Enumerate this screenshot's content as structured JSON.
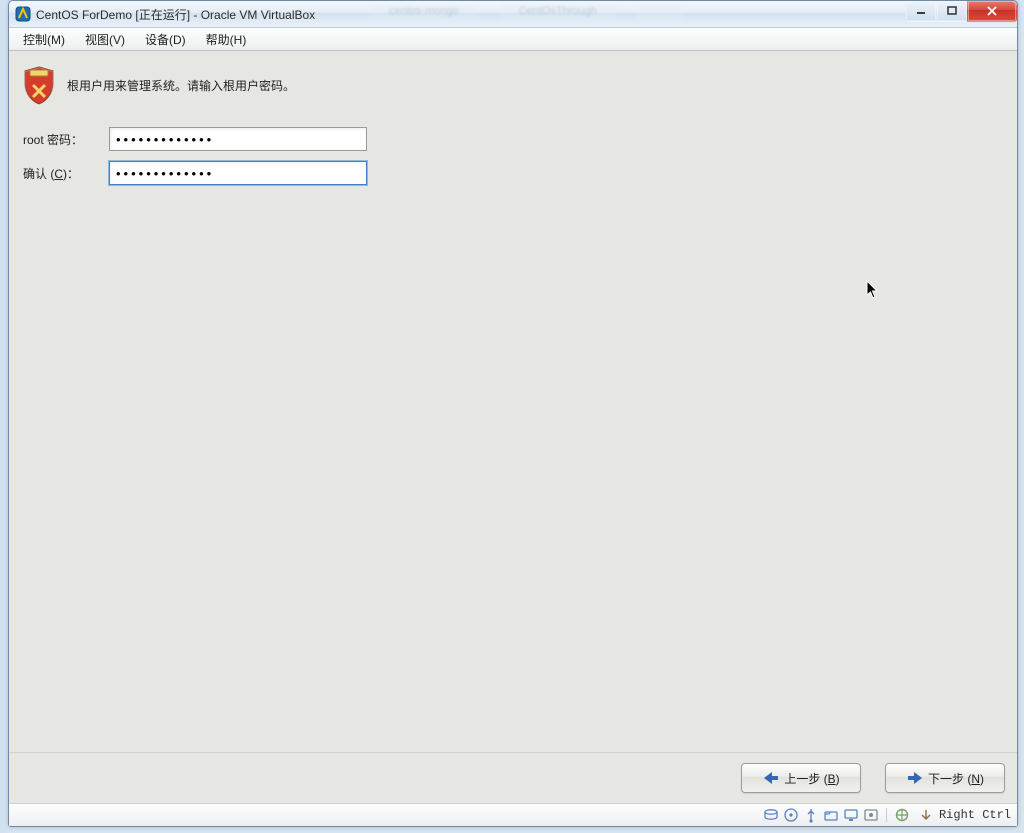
{
  "window": {
    "title": "CentOS ForDemo [正在运行] - Oracle VM VirtualBox"
  },
  "menubar": {
    "items": [
      {
        "label": "控制(M)"
      },
      {
        "label": "视图(V)"
      },
      {
        "label": "设备(D)"
      },
      {
        "label": "帮助(H)"
      }
    ]
  },
  "installer": {
    "header_text": "根用户用来管理系统。请输入根用户密码。",
    "root_label_prefix": "root 密码：",
    "confirm_label_prefix": "确认 (",
    "confirm_label_letter": "C",
    "confirm_label_suffix": ")：",
    "root_value": "•••••••••••••",
    "confirm_value": "•••••••••••••",
    "back_label_prefix": "上一步 (",
    "back_label_letter": "B",
    "back_label_suffix": ")",
    "next_label_prefix": "下一步 (",
    "next_label_letter": "N",
    "next_label_suffix": ")"
  },
  "statusbar": {
    "host_key": "Right Ctrl"
  }
}
